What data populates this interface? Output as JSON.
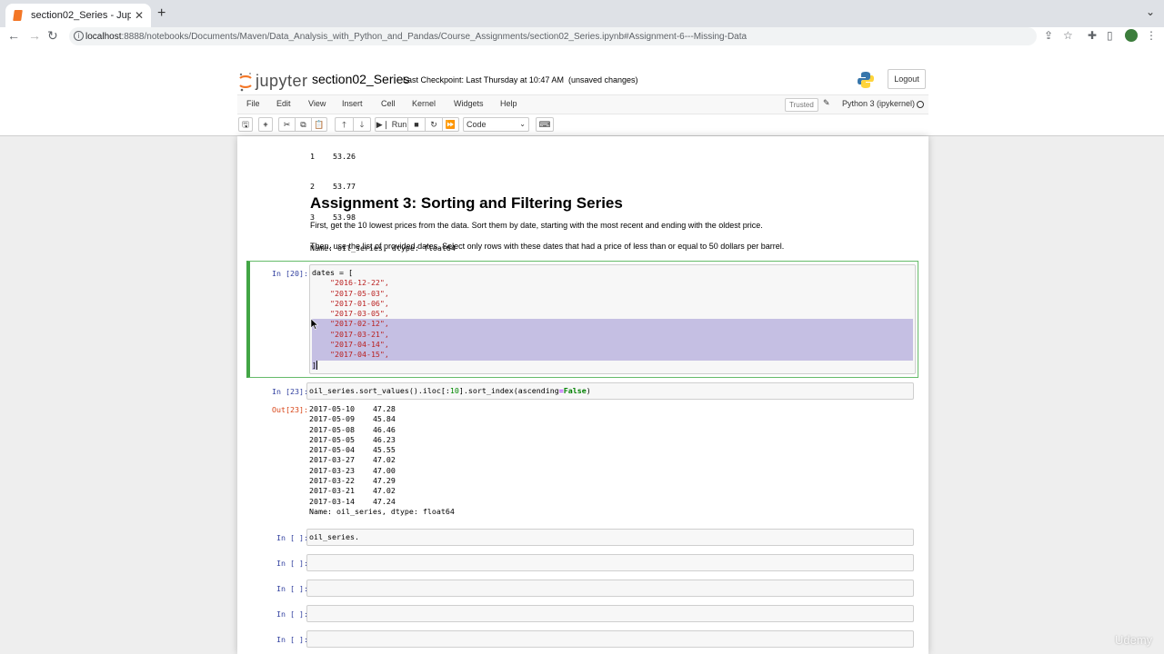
{
  "browser": {
    "tab_title": "section02_Series - Jupyter No",
    "url_host": "localhost",
    "url_path": ":8888/notebooks/Documents/Maven/Data_Analysis_with_Python_and_Pandas/Course_Assignments/section02_Series.ipynb#Assignment-6---Missing-Data"
  },
  "jupyter": {
    "logo_text": "jupyter",
    "notebook_name": "section02_Series",
    "checkpoint": "Last Checkpoint: Last Thursday at 10:47 AM",
    "unsaved": "(unsaved changes)",
    "logout_label": "Logout",
    "menu": [
      "File",
      "Edit",
      "View",
      "Insert",
      "Cell",
      "Kernel",
      "Widgets",
      "Help"
    ],
    "trusted_label": "Trusted",
    "kernel_name": "Python 3 (ipykernel)",
    "run_label": "Run",
    "cell_type": "Code"
  },
  "notebook": {
    "prev_output": [
      "1    53.26",
      "2    53.77",
      "3    53.98",
      "Name: oil_series, dtype: float64"
    ],
    "heading": "Assignment 3: Sorting and Filtering Series",
    "para1": "First, get the 10 lowest prices from the data. Sort them by date, starting with the most recent and ending with the oldest price.",
    "para2": "Then, use the list of provided dates. Select only rows with these dates that had a price of less than or equal to 50 dollars per barrel.",
    "cell1_prompt": "In [20]:",
    "cell1_first": "dates = [",
    "cell1_dates": [
      "\"2016-12-22\",",
      "\"2017-05-03\",",
      "\"2017-01-06\",",
      "\"2017-03-05\",",
      "\"2017-02-12\",",
      "\"2017-03-21\",",
      "\"2017-04-14\",",
      "\"2017-04-15\","
    ],
    "cell1_last": "]",
    "cell2_prompt": "In [23]:",
    "cell2_code_a": "oil_series.sort_values().iloc[:",
    "cell2_code_num": "10",
    "cell2_code_b": "].sort_index(ascending",
    "cell2_code_eq": "=",
    "cell2_code_kw": "False",
    "cell2_code_c": ")",
    "out2_prompt": "Out[23]:",
    "out2_rows": [
      {
        "date": "2017-05-10",
        "value": "47.28"
      },
      {
        "date": "2017-05-09",
        "value": "45.84"
      },
      {
        "date": "2017-05-08",
        "value": "46.46"
      },
      {
        "date": "2017-05-05",
        "value": "46.23"
      },
      {
        "date": "2017-05-04",
        "value": "45.55"
      },
      {
        "date": "2017-03-27",
        "value": "47.02"
      },
      {
        "date": "2017-03-23",
        "value": "47.00"
      },
      {
        "date": "2017-03-22",
        "value": "47.29"
      },
      {
        "date": "2017-03-21",
        "value": "47.02"
      },
      {
        "date": "2017-03-14",
        "value": "47.24"
      }
    ],
    "out2_footer": "Name: oil_series, dtype: float64",
    "empty_prompt": "In [ ]:",
    "cell3_code": "oil_series."
  },
  "watermark": "Udemy"
}
